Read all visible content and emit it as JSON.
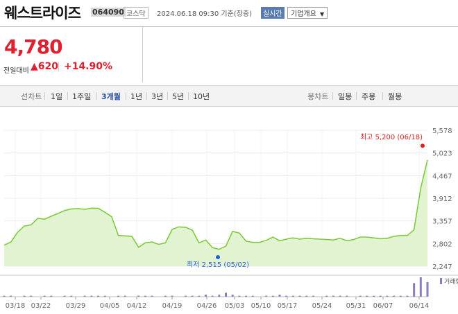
{
  "header": {
    "company": "웨스트라이즈",
    "code": "064090",
    "market": "코스닥",
    "datetime": "2024.06.18 09:30 기준(장중)",
    "realtime_label": "실시간",
    "company_info_label": "기업개요",
    "dropdown_icon": "chevron-down-icon"
  },
  "price": {
    "current": "4,780",
    "change_label": "전일대비",
    "change_arrow": "▲",
    "change_value": "620",
    "change_pct": "+14.90%",
    "color": "#e0202f"
  },
  "period_tabs": {
    "label": "선차트",
    "items": [
      "1일",
      "1주일",
      "3개월",
      "1년",
      "3년",
      "5년",
      "10년"
    ],
    "selected": "3개월"
  },
  "candle_tabs": {
    "label": "봉차트",
    "items": [
      "일봉",
      "주봉",
      "월봉"
    ]
  },
  "chart_data": {
    "type": "area",
    "y_ticks": [
      "5,578",
      "5,023",
      "4,467",
      "3,912",
      "3,357",
      "2,802",
      "2,247"
    ],
    "ylim": [
      2247,
      5578
    ],
    "x_ticks": [
      "03/18",
      "03/22",
      "03/29",
      "04/05",
      "04/12",
      "04/19",
      "04/26",
      "05/03",
      "05/10",
      "05/17",
      "05/24",
      "05/31",
      "06/07",
      "06/14"
    ],
    "series": [
      {
        "values": [
          2760,
          2840,
          3080,
          3230,
          3260,
          3420,
          3400,
          3470,
          3540,
          3610,
          3650,
          3660,
          3640,
          3670,
          3665,
          3570,
          3460,
          3000,
          2990,
          2980,
          2710,
          2820,
          2840,
          2780,
          2820,
          3150,
          3210,
          3200,
          3130,
          2820,
          2890,
          2700,
          2660,
          2740,
          3100,
          3060,
          2860,
          2830,
          2830,
          2880,
          2960,
          2870,
          2910,
          2940,
          2910,
          2930,
          2920,
          2910,
          2900,
          2890,
          2930,
          2870,
          2900,
          2960,
          2960,
          2940,
          2920,
          2930,
          2980,
          3000,
          3000,
          3140,
          4160,
          4850
        ]
      }
    ],
    "high_label": "최고 5,200 (06/18)",
    "high_value": 5200,
    "low_label": "최저 2,515 (05/02)",
    "low_value": 2515,
    "volume": [
      1,
      1,
      0,
      1,
      1,
      0,
      1,
      1,
      0,
      1,
      1,
      0,
      1,
      1,
      1,
      1,
      0,
      1,
      1,
      0,
      1,
      1,
      1,
      0,
      1,
      1,
      0,
      1,
      1,
      1,
      2,
      1,
      2,
      4,
      2,
      1,
      1,
      1,
      0,
      1,
      1,
      2,
      1,
      1,
      1,
      1,
      1,
      0,
      1,
      1,
      1,
      1,
      0,
      1,
      1,
      1,
      1,
      1,
      1,
      1,
      1,
      14,
      20,
      15
    ],
    "volume_legend": "거래량",
    "line_color": "#7fcb3c",
    "fill_color": "#e2f3d2",
    "volume_color": "#8a7cbe",
    "high_marker_color": "#e02020",
    "low_marker_color": "#2a63d6",
    "grid": true
  }
}
